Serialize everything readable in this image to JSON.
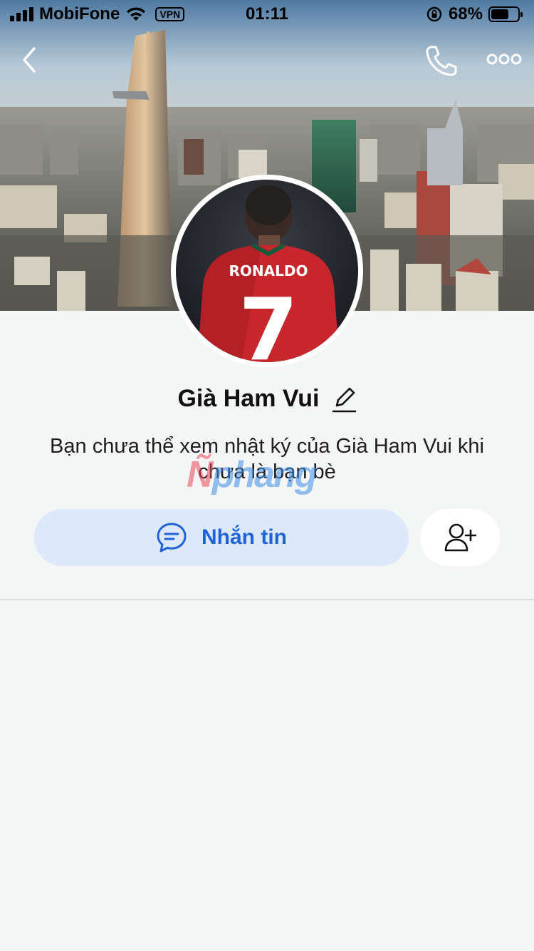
{
  "status_bar": {
    "carrier": "MobiFone",
    "vpn": "VPN",
    "time": "01:11",
    "battery_percent": "68%",
    "battery_level": 0.68,
    "icons": [
      "signal-icon",
      "wifi-icon",
      "rotation-lock-icon",
      "battery-icon"
    ]
  },
  "nav": {
    "icons": [
      "back-icon",
      "phone-icon",
      "more-icon"
    ]
  },
  "profile": {
    "name": "Già Ham Vui",
    "avatar_jersey_text": "RONALDO",
    "avatar_jersey_number": "7",
    "info_text": "Bạn chưa thể xem nhật ký của Già Ham Vui khi chưa là bạn bè",
    "watermark": "Ñphang"
  },
  "actions": {
    "message_label": "Nhắn tin",
    "icons": [
      "chat-icon",
      "add-friend-icon"
    ]
  },
  "colors": {
    "background": "#f4f5f5",
    "primary_blue": "#1f63d6",
    "button_bg": "#dde9fb"
  }
}
